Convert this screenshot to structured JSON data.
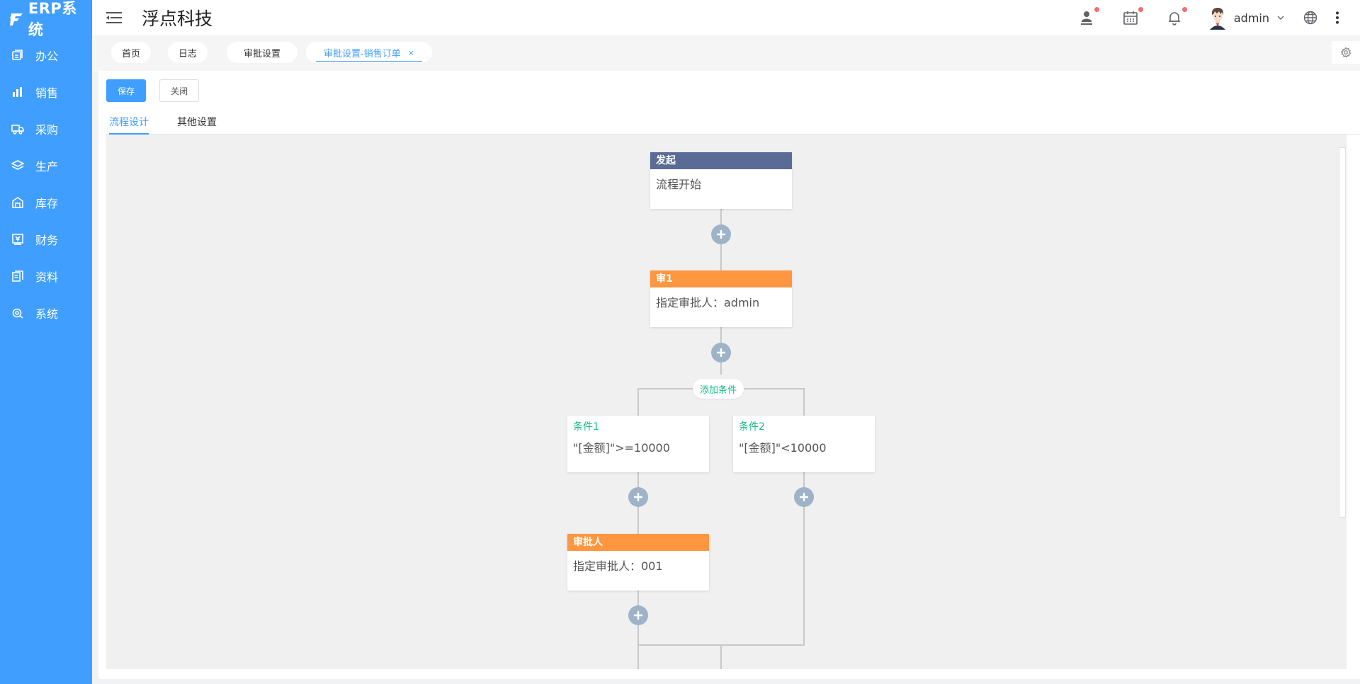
{
  "brand": {
    "logo_text": "ERP系统",
    "company": "浮点科技"
  },
  "colors": {
    "primary": "#409eff",
    "start_node": "#5a6b96",
    "approver_node": "#ff9640",
    "condition_text": "#15bc83",
    "plus_button": "#9fb3c8",
    "badge": "#f56c6c"
  },
  "sidebar": {
    "items": [
      {
        "label": "办公",
        "icon": "office-icon"
      },
      {
        "label": "销售",
        "icon": "chart-bar-icon"
      },
      {
        "label": "采购",
        "icon": "truck-icon"
      },
      {
        "label": "生产",
        "icon": "layers-icon"
      },
      {
        "label": "库存",
        "icon": "warehouse-icon"
      },
      {
        "label": "财务",
        "icon": "finance-icon"
      },
      {
        "label": "资料",
        "icon": "documents-icon"
      },
      {
        "label": "系统",
        "icon": "system-gear-icon"
      }
    ]
  },
  "header": {
    "user": "admin",
    "icons": [
      "user-stamp-icon",
      "calendar-icon",
      "bell-icon",
      "globe-icon",
      "more-icon"
    ]
  },
  "tabs": [
    {
      "label": "首页"
    },
    {
      "label": "日志"
    },
    {
      "label": "审批设置"
    },
    {
      "label": "审批设置-销售订单",
      "active": true,
      "close": "×"
    }
  ],
  "toolbar": {
    "save_label": "保存",
    "close_label": "关闭"
  },
  "subtabs": [
    {
      "label": "流程设计",
      "active": true
    },
    {
      "label": "其他设置"
    }
  ],
  "flow": {
    "start": {
      "title": "发起",
      "text": "流程开始"
    },
    "approver1": {
      "title": "审1",
      "text": "指定审批人：admin"
    },
    "add_condition": "添加条件",
    "conditions": [
      {
        "title": "条件1",
        "expr": "\"[金额]\">=10000"
      },
      {
        "title": "条件2",
        "expr": "\"[金额]\"<10000"
      }
    ],
    "approver2": {
      "title": "审批人",
      "text": "指定审批人：001"
    }
  }
}
